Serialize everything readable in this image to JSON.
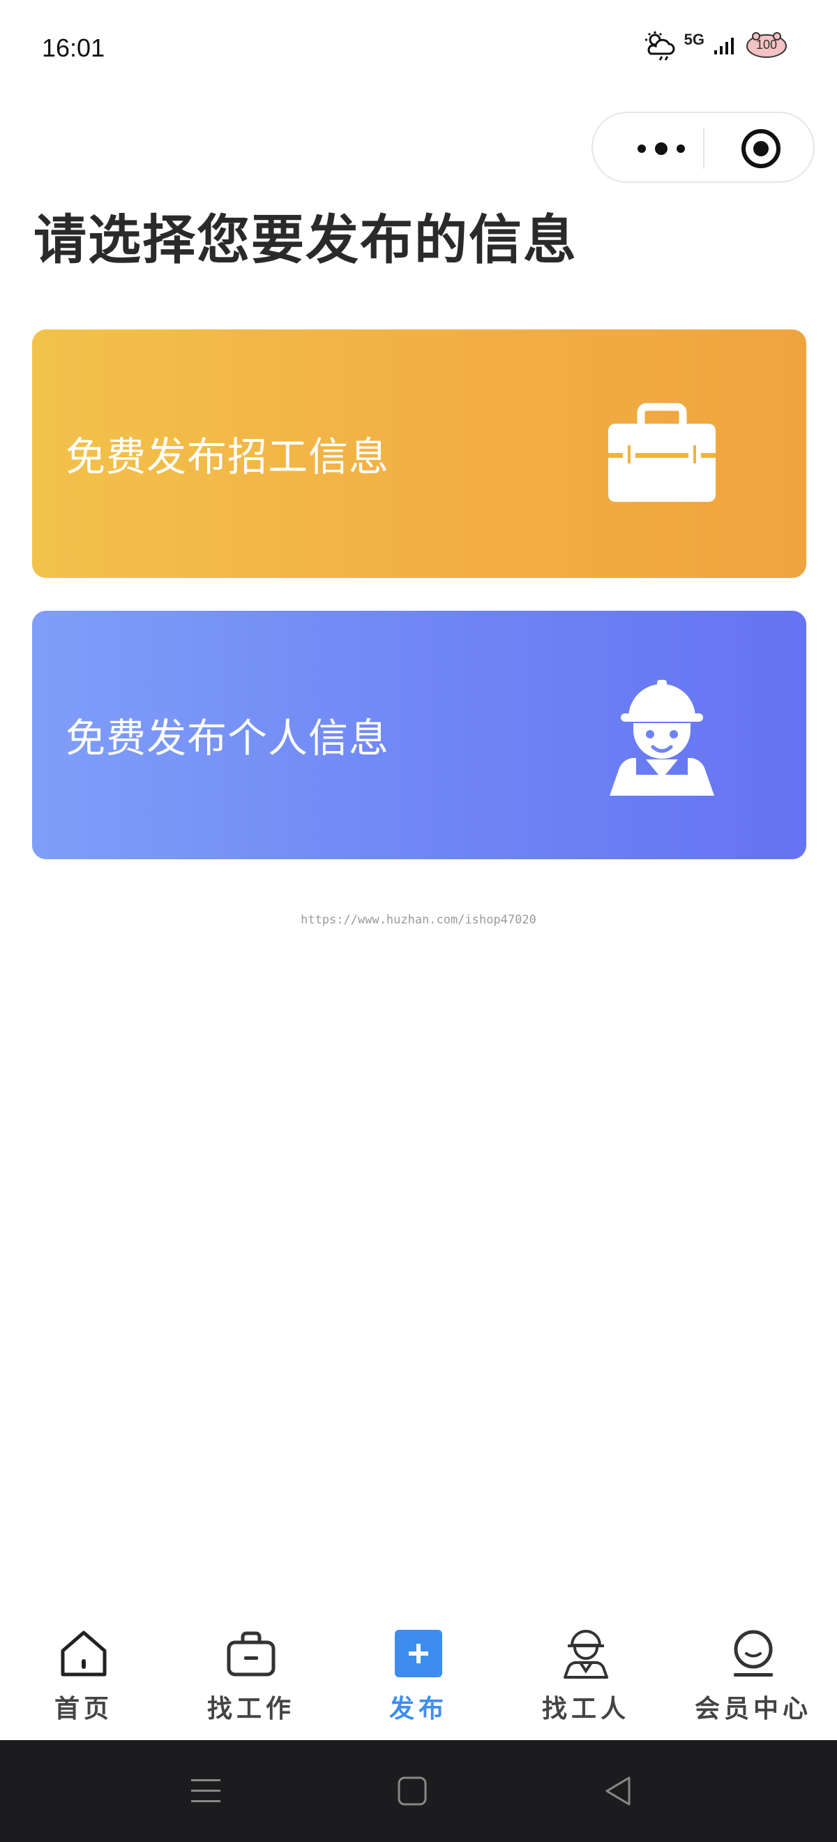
{
  "status_bar": {
    "time": "16:01",
    "network": "5G",
    "battery": "100",
    "icons": [
      "weather-icon",
      "signal-icon",
      "battery-icon"
    ]
  },
  "capsule": {
    "icons": [
      "more-icon",
      "close-target-icon"
    ]
  },
  "page": {
    "title": "请选择您要发布的信息"
  },
  "cards": [
    {
      "label": "免费发布招工信息",
      "icon": "toolbox-icon",
      "colors": [
        "#f2c24a",
        "#f0a43f"
      ]
    },
    {
      "label": "免费发布个人信息",
      "icon": "worker-icon",
      "colors": [
        "#7f9ef8",
        "#6574f2"
      ]
    }
  ],
  "watermark": "https://www.huzhan.com/ishop47020",
  "tabbar": {
    "active_color": "#3d8df0",
    "items": [
      {
        "label": "首页",
        "icon": "home-icon",
        "active": false
      },
      {
        "label": "找工作",
        "icon": "briefcase-icon",
        "active": false
      },
      {
        "label": "发布",
        "icon": "plus-icon",
        "active": true
      },
      {
        "label": "找工人",
        "icon": "worker-icon",
        "active": false
      },
      {
        "label": "会员中心",
        "icon": "member-icon",
        "active": false
      }
    ]
  },
  "system_nav": {
    "icons": [
      "menu-icon",
      "home-square-icon",
      "back-triangle-icon"
    ]
  }
}
